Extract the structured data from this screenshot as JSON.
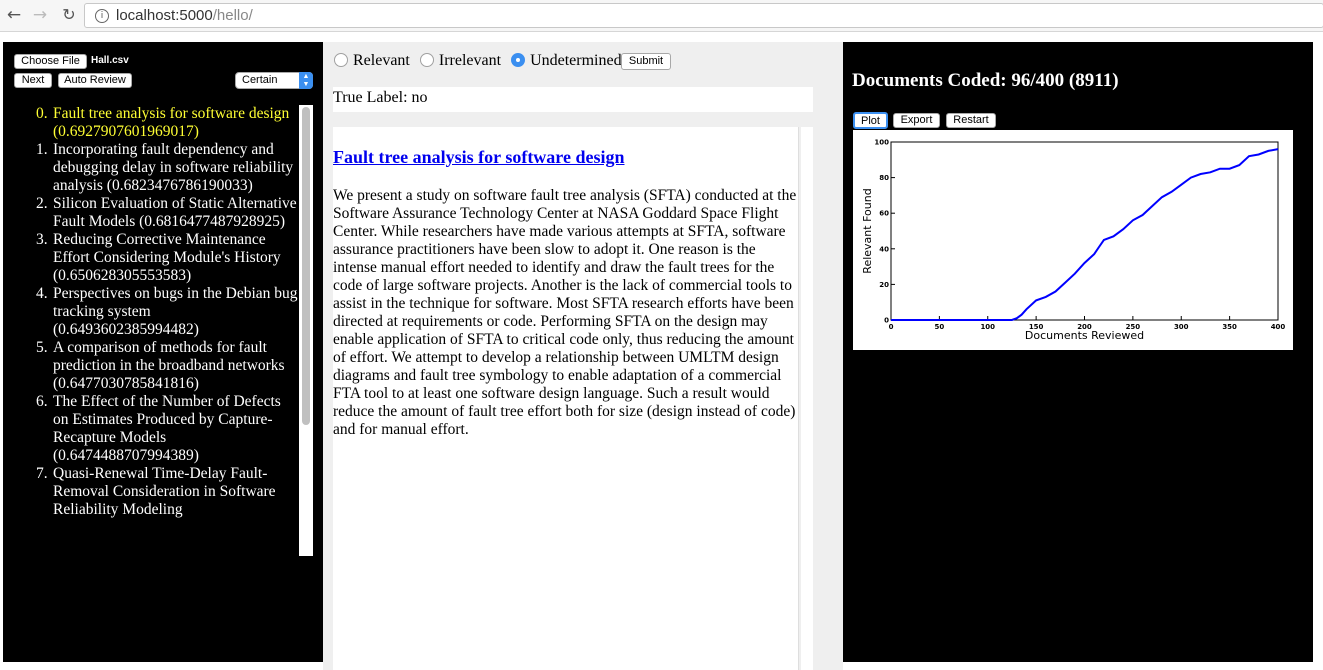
{
  "browser": {
    "back_icon": "←",
    "forward_icon": "→",
    "reload_icon": "↻",
    "info_icon": "i",
    "url_host": "localhost:5000",
    "url_path": "/hello/"
  },
  "left": {
    "choose_file_label": "Choose File",
    "file_name": "Hall.csv",
    "next_label": "Next",
    "auto_review_label": "Auto Review",
    "certainty_selected": "Certain",
    "select_arrows": "▲\n▼",
    "highlight_color": "#ffff33",
    "documents": [
      {
        "index": "0.",
        "text": "Fault tree analysis for software design (0.6927907601969017)",
        "active": true
      },
      {
        "index": "1.",
        "text": "Incorporating fault dependency and debugging delay in software reliability analysis (0.6823476786190033)",
        "active": false
      },
      {
        "index": "2.",
        "text": "Silicon Evaluation of Static Alternative Fault Models (0.6816477487928925)",
        "active": false
      },
      {
        "index": "3.",
        "text": "Reducing Corrective Maintenance Effort Considering Module's History (0.650628305553583)",
        "active": false
      },
      {
        "index": "4.",
        "text": "Perspectives on bugs in the Debian bug tracking system (0.6493602385994482)",
        "active": false
      },
      {
        "index": "5.",
        "text": "A comparison of methods for fault prediction in the broadband networks (0.6477030785841816)",
        "active": false
      },
      {
        "index": "6.",
        "text": "The Effect of the Number of Defects on Estimates Produced by Capture-Recapture Models (0.6474488707994389)",
        "active": false
      },
      {
        "index": "7.",
        "text": "Quasi-Renewal Time-Delay Fault-Removal Consideration in Software Reliability Modeling",
        "active": false
      }
    ]
  },
  "middle": {
    "radio_relevant": "Relevant",
    "radio_irrelevant": "Irrelevant",
    "radio_undetermined": "Undetermined",
    "selected_radio": "Undetermined",
    "submit_label": "Submit",
    "true_label_text": "True Label: no",
    "doc_title": "Fault tree analysis for software design",
    "doc_abstract": "We present a study on software fault tree analysis (SFTA) conducted at the Software Assurance Technology Center at NASA Goddard Space Flight Center. While researchers have made various attempts at SFTA, software assurance practitioners have been slow to adopt it. One reason is the intense manual effort needed to identify and draw the fault trees for the code of large software projects. Another is the lack of commercial tools to assist in the technique for software. Most SFTA research efforts have been directed at requirements or code. Performing SFTA on the design may enable application of SFTA to critical code only, thus reducing the amount of effort. We attempt to develop a relationship between UMLTM design diagrams and fault tree symbology to enable adaptation of a commercial FTA tool to at least one software design language. Such a result would reduce the amount of fault tree effort both for size (design instead of code) and for manual effort."
  },
  "right": {
    "coded_text": "Documents Coded: 96/400 (8911)",
    "plot_label": "Plot",
    "export_label": "Export",
    "restart_label": "Restart"
  },
  "chart_data": {
    "type": "line",
    "title": "",
    "xlabel": "Documents Reviewed",
    "ylabel": "Relevant Found",
    "xlim": [
      0,
      400
    ],
    "ylim": [
      0,
      100
    ],
    "xticks": [
      0,
      50,
      100,
      150,
      200,
      250,
      300,
      350,
      400
    ],
    "yticks": [
      0,
      20,
      40,
      60,
      80,
      100
    ],
    "line_color": "#0000ff",
    "series": [
      {
        "x": [
          0,
          50,
          100,
          125,
          130,
          135,
          140,
          150,
          160,
          170,
          180,
          190,
          200,
          210,
          215,
          220,
          230,
          240,
          250,
          260,
          270,
          280,
          290,
          300,
          310,
          320,
          330,
          340,
          350,
          360,
          370,
          380,
          390,
          400
        ],
        "y": [
          0,
          0,
          0,
          0,
          1,
          3,
          6,
          11,
          13,
          16,
          21,
          26,
          32,
          37,
          41,
          45,
          47,
          51,
          56,
          59,
          64,
          69,
          72,
          76,
          80,
          82,
          83,
          85,
          85,
          87,
          92,
          93,
          95,
          96
        ]
      }
    ]
  }
}
